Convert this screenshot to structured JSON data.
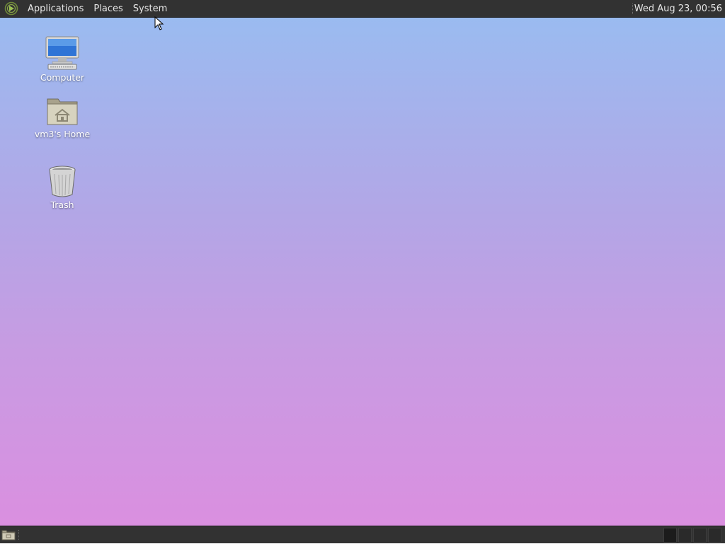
{
  "top_panel": {
    "menus": [
      {
        "label": "Applications"
      },
      {
        "label": "Places"
      },
      {
        "label": "System"
      }
    ],
    "clock": "Wed Aug 23, 00:56"
  },
  "desktop": {
    "icons": [
      {
        "label": "Computer",
        "icon": "computer-icon"
      },
      {
        "label": "vm3's Home",
        "icon": "home-folder-icon"
      },
      {
        "label": "Trash",
        "icon": "trash-icon"
      }
    ]
  },
  "bottom_panel": {
    "workspaces": 4,
    "active_workspace": 1
  },
  "colors": {
    "panel": "#323232",
    "gradient_top": "#98bdf1",
    "gradient_bottom": "#dc8ee0"
  }
}
